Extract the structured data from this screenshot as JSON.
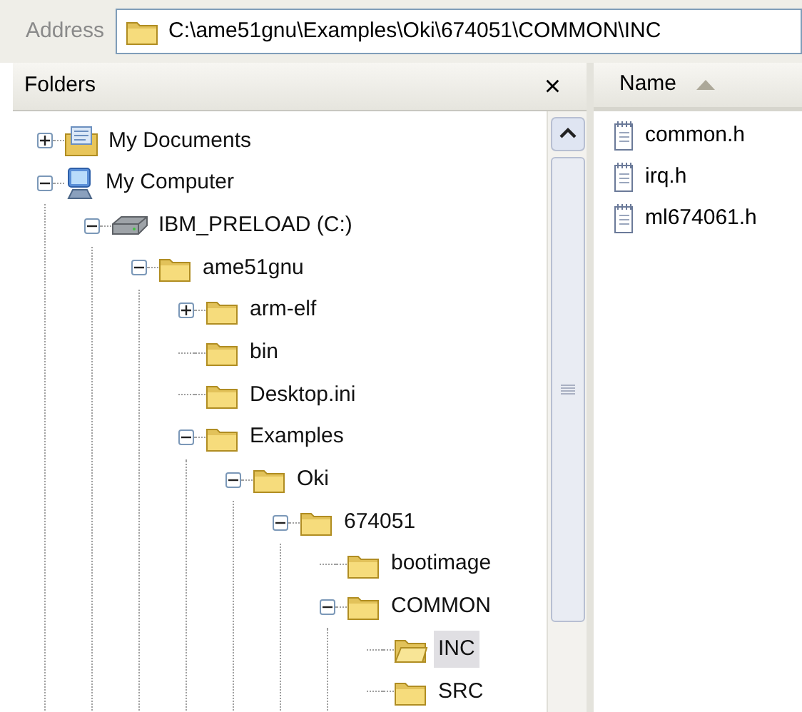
{
  "address_bar": {
    "label": "Address",
    "value": "C:\\ame51gnu\\Examples\\Oki\\674051\\COMMON\\INC"
  },
  "folders_pane": {
    "title": "Folders",
    "close": "×",
    "tree": [
      {
        "label": "My Documents",
        "kind": "documents",
        "expanded": false,
        "selected": false
      },
      {
        "label": "My Computer",
        "kind": "computer",
        "expanded": true,
        "selected": false,
        "children": [
          {
            "label": "IBM_PRELOAD (C:)",
            "kind": "drive",
            "expanded": true,
            "selected": false,
            "children": [
              {
                "label": "ame51gnu",
                "kind": "folder",
                "expanded": true,
                "selected": false,
                "children": [
                  {
                    "label": "arm-elf",
                    "kind": "folder",
                    "expanded": false,
                    "selected": false
                  },
                  {
                    "label": "bin",
                    "kind": "folder",
                    "selected": false
                  },
                  {
                    "label": "Desktop.ini",
                    "kind": "folder",
                    "selected": false
                  },
                  {
                    "label": "Examples",
                    "kind": "folder",
                    "expanded": true,
                    "selected": false,
                    "children": [
                      {
                        "label": "Oki",
                        "kind": "folder",
                        "expanded": true,
                        "selected": false,
                        "children": [
                          {
                            "label": "674051",
                            "kind": "folder",
                            "expanded": true,
                            "selected": false,
                            "children": [
                              {
                                "label": "bootimage",
                                "kind": "folder",
                                "selected": false
                              },
                              {
                                "label": "COMMON",
                                "kind": "folder",
                                "expanded": true,
                                "selected": false,
                                "children": [
                                  {
                                    "label": "INC",
                                    "kind": "folder",
                                    "selected": true
                                  },
                                  {
                                    "label": "SRC",
                                    "kind": "folder",
                                    "selected": false
                                  }
                                ]
                              }
                            ]
                          }
                        ]
                      }
                    ]
                  }
                ]
              }
            ]
          }
        ]
      }
    ]
  },
  "file_list": {
    "columns": [
      {
        "label": "Name",
        "sorted": true
      }
    ],
    "files": [
      {
        "name": "common.h"
      },
      {
        "name": "irq.h"
      },
      {
        "name": "ml674061.h"
      }
    ]
  }
}
